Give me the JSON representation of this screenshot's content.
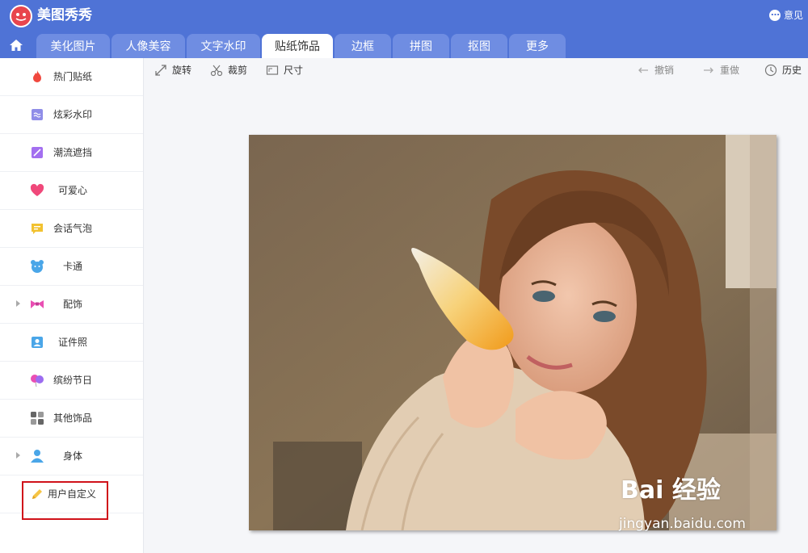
{
  "app": {
    "title": "美图秀秀",
    "feedback_label": "意见"
  },
  "tabs": [
    {
      "label": "美化图片",
      "active": false
    },
    {
      "label": "人像美容",
      "active": false
    },
    {
      "label": "文字水印",
      "active": false
    },
    {
      "label": "贴纸饰品",
      "active": true
    },
    {
      "label": "边框",
      "active": false
    },
    {
      "label": "拼图",
      "active": false
    },
    {
      "label": "抠图",
      "active": false
    },
    {
      "label": "更多",
      "active": false
    }
  ],
  "sidebar": {
    "items": [
      {
        "label": "热门贴纸",
        "icon": "flame-icon",
        "expandable": false
      },
      {
        "label": "炫彩水印",
        "icon": "watermark-icon",
        "expandable": false
      },
      {
        "label": "潮流遮挡",
        "icon": "mask-icon",
        "expandable": false
      },
      {
        "label": "可爱心",
        "icon": "heart-icon",
        "expandable": false
      },
      {
        "label": "会话气泡",
        "icon": "chat-bubble-icon",
        "expandable": false
      },
      {
        "label": "卡通",
        "icon": "bear-icon",
        "expandable": false
      },
      {
        "label": "配饰",
        "icon": "bow-icon",
        "expandable": true
      },
      {
        "label": "证件照",
        "icon": "id-photo-icon",
        "expandable": false
      },
      {
        "label": "缤纷节日",
        "icon": "balloon-icon",
        "expandable": false
      },
      {
        "label": "其他饰品",
        "icon": "grid-icon",
        "expandable": false
      },
      {
        "label": "身体",
        "icon": "person-icon",
        "expandable": true
      },
      {
        "label": "用户自定义",
        "icon": "pencil-icon",
        "expandable": false
      }
    ]
  },
  "toolbar": {
    "rotate": "旋转",
    "crop": "裁剪",
    "size": "尺寸",
    "undo": "撤销",
    "redo": "重做",
    "history": "历史"
  },
  "watermark": {
    "brand": "Bai 经验",
    "url": "jingyan.baidu.com"
  },
  "colors": {
    "header_blue": "#4f73d6",
    "tab_inactive": "#6f8de2",
    "highlight_red": "#d0121a"
  }
}
